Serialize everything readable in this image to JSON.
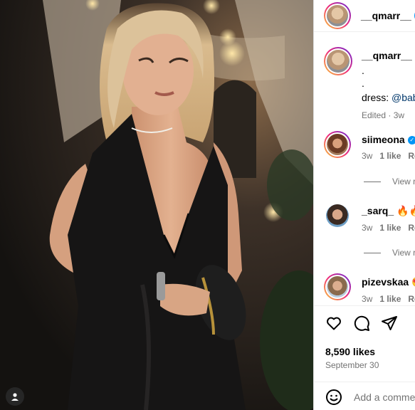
{
  "header": {
    "username": "__qmarr__",
    "verified": true
  },
  "caption": {
    "username": "__qmarr__",
    "lines": [
      ".",
      "."
    ],
    "dress_label": "dress:",
    "mention": "@bab",
    "meta": "Edited · 3w"
  },
  "comments": [
    {
      "username": "siimeona",
      "verified": true,
      "text": "",
      "age": "3w",
      "likes": "1 like",
      "reply": "Re"
    },
    {
      "username": "_sarq_",
      "verified": false,
      "text": "🔥🔥",
      "age": "3w",
      "likes": "1 like",
      "reply": "Re"
    },
    {
      "username": "pizevskaa",
      "verified": false,
      "text": "😍",
      "age": "3w",
      "likes": "1 like",
      "reply": "Re"
    }
  ],
  "view_replies": [
    "View r",
    "View r"
  ],
  "actions": {
    "likes": "8,590 likes",
    "date": "September 30"
  },
  "add_comment": {
    "placeholder": "Add a comme"
  },
  "colors": {
    "verified_blue": "#0095f6",
    "mention": "#00376b",
    "muted": "#737373"
  }
}
